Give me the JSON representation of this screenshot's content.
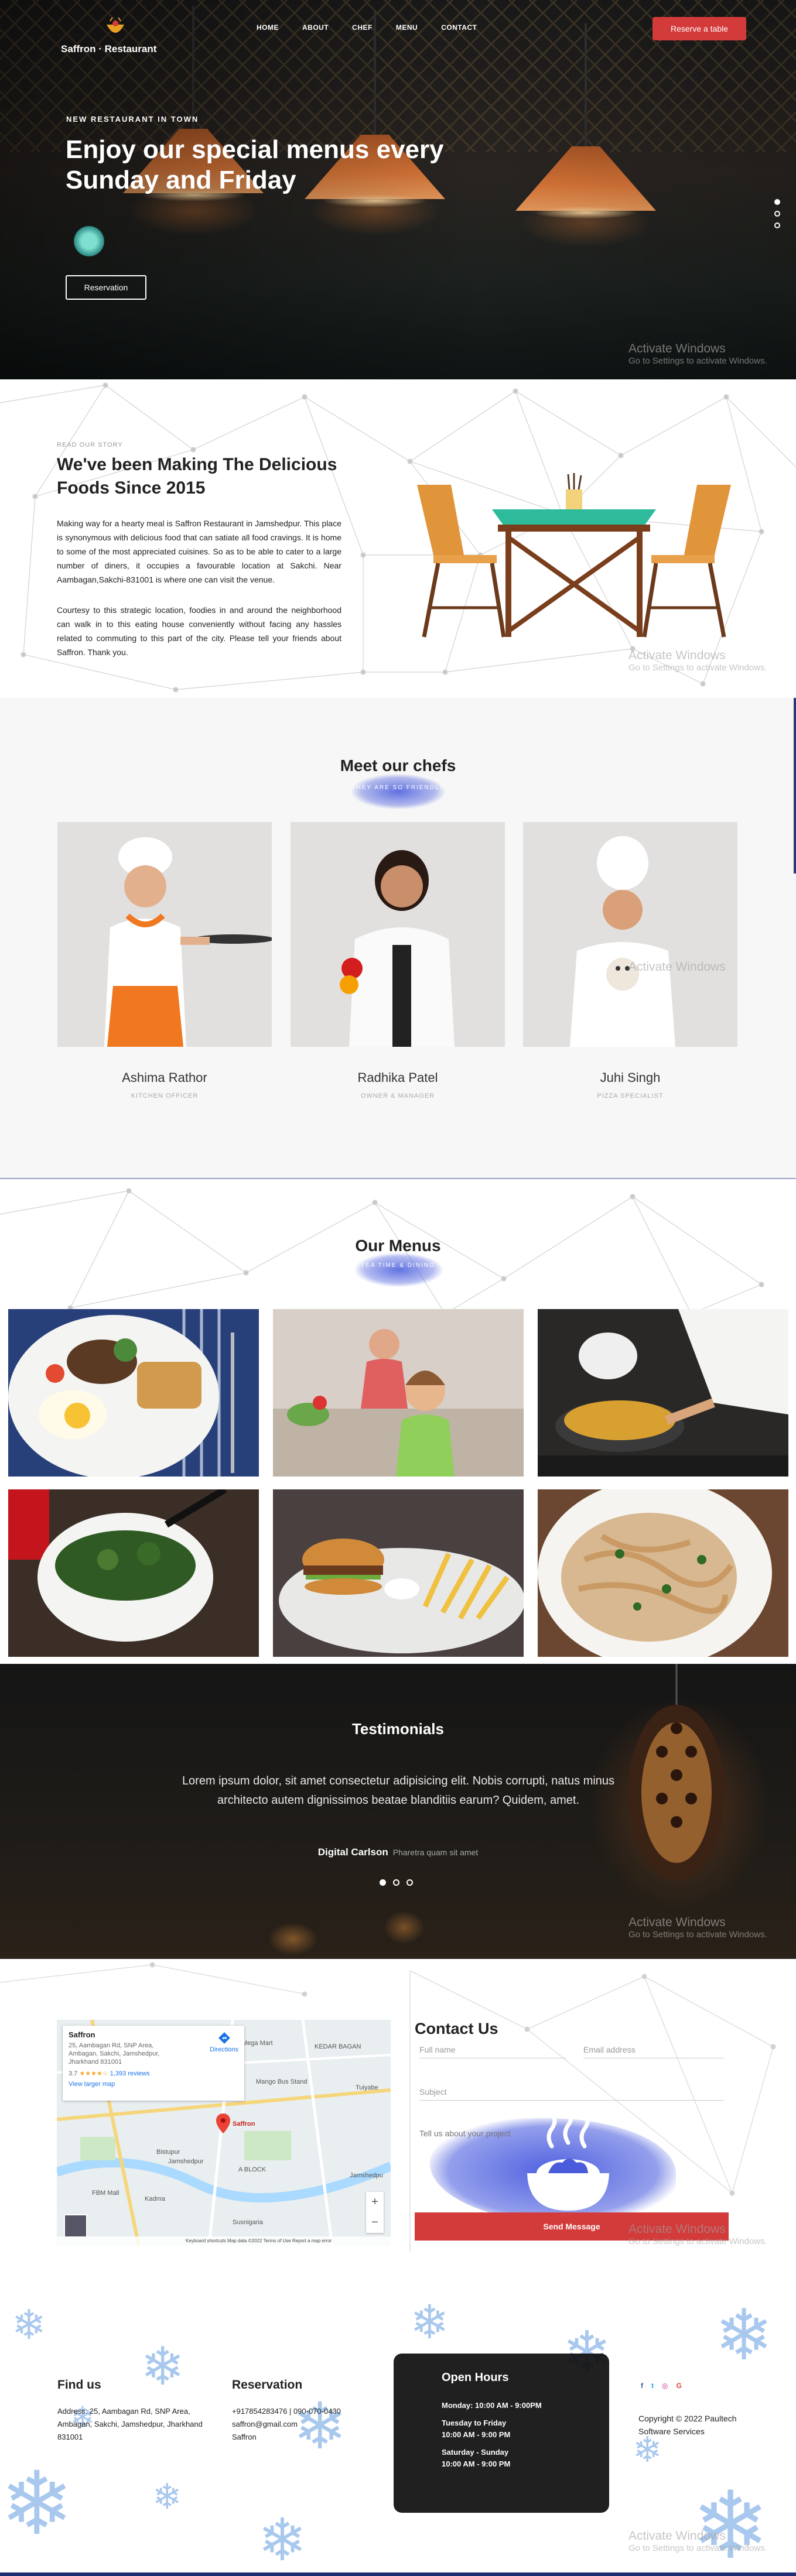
{
  "nav": {
    "brand": "Saffron · Restaurant",
    "links": [
      "HOME",
      "ABOUT",
      "CHEF",
      "MENU",
      "CONTACT"
    ],
    "reserve_label": "Reserve a table"
  },
  "hero": {
    "tagline": "NEW RESTAURANT IN TOWN",
    "title": "Enjoy our special menus every Sunday and Friday",
    "button_label": "Reservation",
    "slides": 3,
    "active_slide": 1
  },
  "watermark": {
    "title": "Activate Windows",
    "subtitle": "Go to Settings to activate Windows."
  },
  "story": {
    "kicker": "READ OUR STORY",
    "title": "We've been Making The Delicious Foods Since 2015",
    "paragraph1": "Making way for a hearty meal is Saffron Restaurant in Jamshedpur. This place is synonymous with delicious food that can satiate all food cravings. It is home to some of the most appreciated cuisines. So as to be able to cater to a large number of diners, it occupies a favourable location at Sakchi. Near Aambagan,Sakchi-831001 is where one can visit the venue.",
    "paragraph2": "Courtesy to this strategic location, foodies in and around the neighborhood can walk in to this eating house conveniently without facing any hassles related to commuting to this part of the city. Please tell your friends about Saffron. Thank you."
  },
  "chefs": {
    "title": "Meet our chefs",
    "subtitle": "THEY ARE SO FRIENDLY",
    "items": [
      {
        "name": "Ashima Rathor",
        "role": "KITCHEN OFFICER"
      },
      {
        "name": "Radhika Patel",
        "role": "OWNER & MANAGER"
      },
      {
        "name": "Juhi Singh",
        "role": "PIZZA SPECIALIST"
      }
    ]
  },
  "menus": {
    "title": "Our Menus",
    "subtitle": "TEA TIME & DINING"
  },
  "testimonials": {
    "title": "Testimonials",
    "quote": "Lorem ipsum dolor, sit amet consectetur adipisicing elit. Nobis corrupti, natus minus architecto autem dignissimos beatae blanditiis earum? Quidem, amet.",
    "author": "Digital Carlson",
    "author_note": "Pharetra quam sit amet",
    "slides": 3,
    "active_slide": 1
  },
  "map": {
    "place_name": "Saffron",
    "address": "25, Aambagan Rd, SNP Area, Ambagan, Sakchi, Jamshedpur, Jharkhand 831001",
    "rating": "3.7",
    "stars": "★★★★☆",
    "reviews": "1,393 reviews",
    "larger_map": "View larger map",
    "directions": "Directions",
    "labels": [
      "Mega Mart",
      "KEDAR BAGAN",
      "Mango Bus Stand",
      "Tuiyabe",
      "Saffron",
      "A BLOCK",
      "Susnigaria",
      "Jamshedpu",
      "Bistupur",
      "Jamshedpur",
      "Kadma",
      "FBM Mall"
    ],
    "footer": "Keyboard shortcuts   Map data ©2022   Terms of Use   Report a map error"
  },
  "contact": {
    "title": "Contact Us",
    "name_placeholder": "Full name",
    "email_placeholder": "Email address",
    "subject_placeholder": "Subject",
    "message_placeholder": "Tell us about your project",
    "send_label": "Send Message"
  },
  "footer": {
    "find_title": "Find us",
    "find_address": "Address: 25, Aambagan Rd, SNP Area, Ambagan, Sakchi, Jamshedpur, Jharkhand 831001",
    "reservation_title": "Reservation",
    "phone": "+917854283476 | 090-070-0430",
    "email": "saffron@gmail.com",
    "brand": "Saffron",
    "hours_title": "Open Hours",
    "hours": [
      {
        "days": "Monday: 10:00 AM - 9:00PM",
        "time": ""
      },
      {
        "days": "Tuesday to Friday",
        "time": "10:00 AM - 9:00 PM"
      },
      {
        "days": "Saturday - Sunday",
        "time": "10:00 AM - 9:00 PM"
      }
    ],
    "copyright": "Copyright © 2022 Paultech Software Services"
  },
  "colors": {
    "accent": "#d33a3a",
    "brush": "#4a5cdc",
    "dark_card": "#141414",
    "footer_bar": "#1f2d75"
  }
}
